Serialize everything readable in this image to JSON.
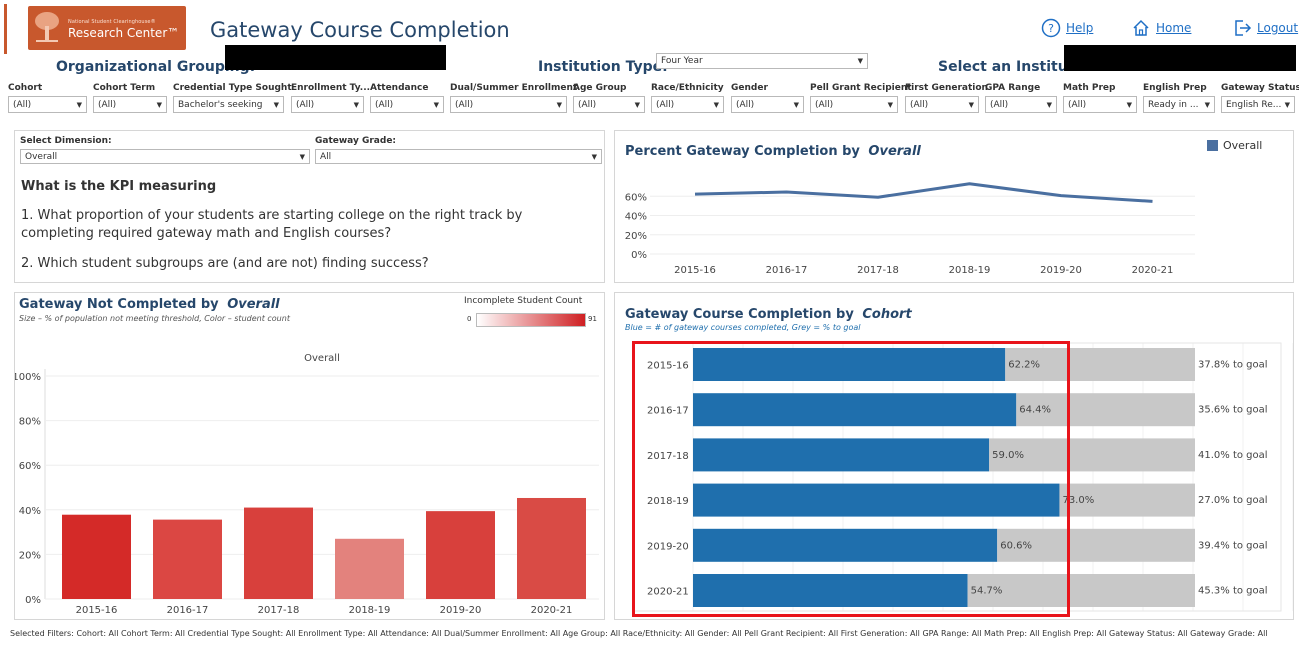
{
  "header": {
    "logo_line1": "National Student Clearinghouse®",
    "logo_line2": "Research Center™",
    "title": "Gateway Course Completion",
    "help": "Help",
    "home": "Home",
    "logout": "Logout"
  },
  "org": {
    "org_grouping_label": "Organizational Grouping:",
    "institution_type_label": "Institution Type:",
    "institution_type_value": "Four Year",
    "select_institution_label": "Select an Institution:"
  },
  "filters": [
    {
      "label": "Cohort",
      "value": "(All)"
    },
    {
      "label": "Cohort Term",
      "value": "(All)"
    },
    {
      "label": "Credential Type Sought",
      "value": "Bachelor's seeking"
    },
    {
      "label": "Enrollment Ty...",
      "value": "(All)"
    },
    {
      "label": "Attendance",
      "value": "(All)"
    },
    {
      "label": "Dual/Summer Enrollment",
      "value": "(All)"
    },
    {
      "label": "Age Group",
      "value": "(All)"
    },
    {
      "label": "Race/Ethnicity",
      "value": "(All)"
    },
    {
      "label": "Gender",
      "value": "(All)"
    },
    {
      "label": "Pell Grant Recipient",
      "value": "(All)"
    },
    {
      "label": "First Generation",
      "value": "(All)"
    },
    {
      "label": "GPA Range",
      "value": "(All)"
    },
    {
      "label": "Math Prep",
      "value": "(All)"
    },
    {
      "label": "English Prep",
      "value": "Ready in ..."
    },
    {
      "label": "Gateway Status",
      "value": "English Re..."
    }
  ],
  "kpi": {
    "select_dimension_label": "Select Dimension:",
    "select_dimension_value": "Overall",
    "gateway_grade_label": "Gateway Grade:",
    "gateway_grade_value": "All",
    "heading": "What is the KPI measuring",
    "q1": "1. What proportion of your students are starting college on the right track by completing required gateway math and English courses?",
    "q2": "2. Which student subgroups are (and are not) finding success?"
  },
  "line_panel": {
    "title_prefix": "Percent Gateway Completion by",
    "title_dim": "Overall",
    "legend": "Overall",
    "color": "#4a6fa0"
  },
  "not_completed_panel": {
    "title_prefix": "Gateway Not Completed by",
    "title_dim": "Overall",
    "subtitle": "Size – % of population not meeting threshold,  Color – student count",
    "legend_title": "Incomplete Student Count",
    "legend_min": "0",
    "legend_max": "91",
    "facet_label": "Overall"
  },
  "cohort_panel": {
    "title_prefix": "Gateway Course Completion by",
    "title_dim": "Cohort",
    "subtitle": "Blue = # of gateway courses completed, Grey = % to goal"
  },
  "chart_data": [
    {
      "type": "line",
      "x": [
        "2015-16",
        "2016-17",
        "2017-18",
        "2018-19",
        "2019-20",
        "2020-21"
      ],
      "series": [
        {
          "name": "Overall",
          "values": [
            62.2,
            64.4,
            59.0,
            73.0,
            60.6,
            54.7
          ]
        }
      ],
      "yticks": [
        "0%",
        "20%",
        "40%",
        "60%"
      ],
      "ylim": [
        0,
        80
      ]
    },
    {
      "type": "bar",
      "categories": [
        "2015-16",
        "2016-17",
        "2017-18",
        "2018-19",
        "2019-20",
        "2020-21"
      ],
      "values": [
        37.8,
        35.6,
        41.0,
        27.0,
        39.4,
        45.3
      ],
      "colors": [
        "#d42a28",
        "#db4743",
        "#d8403c",
        "#e3827d",
        "#d8403c",
        "#d94b45"
      ],
      "yticks": [
        "0%",
        "20%",
        "40%",
        "60%",
        "80%",
        "100%"
      ],
      "ylim": [
        0,
        100
      ]
    },
    {
      "type": "bar",
      "orientation": "horizontal",
      "stacked": true,
      "categories": [
        "2015-16",
        "2016-17",
        "2017-18",
        "2018-19",
        "2019-20",
        "2020-21"
      ],
      "series": [
        {
          "values": [
            62.2,
            64.4,
            59.0,
            73.0,
            60.6,
            54.7
          ],
          "labels": [
            "62.2%",
            "64.4%",
            "59.0%",
            "73.0%",
            "60.6%",
            "54.7%"
          ],
          "color": "#1f6fad"
        },
        {
          "values": [
            37.8,
            35.6,
            41.0,
            27.0,
            39.4,
            45.3
          ],
          "labels": [
            "37.8% to goal",
            "35.6% to goal",
            "41.0% to goal",
            "27.0% to goal",
            "39.4% to goal",
            "45.3% to goal"
          ],
          "color": "#c8c8c8"
        }
      ]
    }
  ],
  "footer": {
    "text": "Selected Filters:   Cohort: All   Cohort Term: All   Credential Type Sought: All   Enrollment Type: All   Attendance: All   Dual/Summer Enrollment: All   Age Group: All   Race/Ethnicity: All   Gender: All   Pell Grant Recipient: All   First Generation: All   GPA Range: All   Math Prep: All   English Prep: All   Gateway Status: All   Gateway Grade: All"
  }
}
